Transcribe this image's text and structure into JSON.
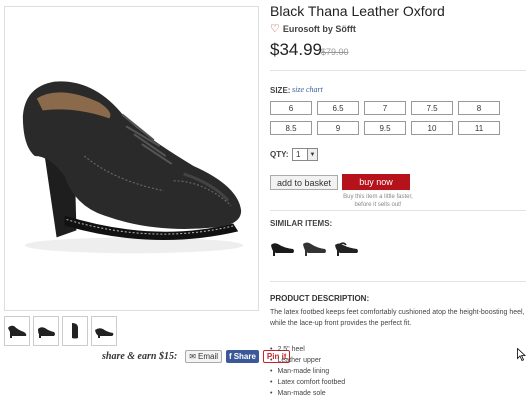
{
  "product": {
    "title": "Black Thana Leather Oxford",
    "brand": "Eurosoft by Söfft",
    "price": "$34.99",
    "original_price": "$79.00"
  },
  "size": {
    "label": "SIZE:",
    "chart_link": "size chart",
    "options": [
      "6",
      "6.5",
      "7",
      "7.5",
      "8",
      "8.5",
      "9",
      "9.5",
      "10",
      "11"
    ]
  },
  "quantity": {
    "label": "QTY:",
    "value": "1"
  },
  "actions": {
    "add_to_basket": "add to basket",
    "buy_now": "buy now",
    "buy_note": "Buy this item a little faster, before it sells out!"
  },
  "similar": {
    "label": "SIMILAR ITEMS:"
  },
  "share": {
    "text": "share & earn $15:",
    "email": "Email",
    "facebook": "Share",
    "pinterest": "Pin it"
  },
  "description": {
    "title": "PRODUCT DESCRIPTION:",
    "text": "The latex footbed keeps feet comfortably cushioned atop the height-boosting heel, while the lace-up front provides the perfect fit.",
    "features": [
      "2.5\" heel",
      "Leather upper",
      "Man-made lining",
      "Latex comfort footbed",
      "Man-made sole"
    ]
  },
  "icons": {
    "favorite": "heart-icon",
    "facebook": "facebook-icon",
    "email": "email-icon"
  },
  "colors": {
    "buy_button": "#b5121b",
    "link": "#3a5f9c",
    "heart": "#c8232c"
  }
}
